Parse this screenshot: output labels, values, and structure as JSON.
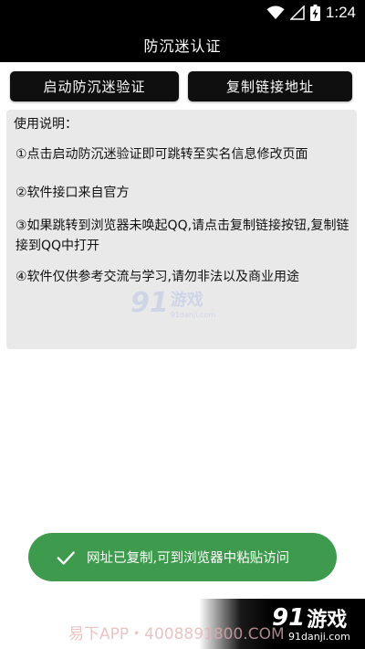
{
  "status_bar": {
    "time": "1:24",
    "icons": [
      "wifi-icon",
      "signal-icon",
      "battery-charging-icon"
    ]
  },
  "app_bar": {
    "title": "防沉迷认证"
  },
  "buttons": {
    "start_verify": "启动防沉迷验证",
    "copy_link": "复制链接地址"
  },
  "instructions": {
    "title": "使用说明：",
    "items": [
      "①点击启动防沉迷验证即可跳转至实名信息修改页面",
      "②软件接口来自官方",
      "③如果跳转到浏览器未唤起QQ,请点击复制链接按钮,复制链接到QQ中打开",
      "④软件仅供参考交流与学习,请勿非法以及商业用途"
    ]
  },
  "toast": {
    "message": "网址已复制,可到浏览器中粘贴访问",
    "icon": "check-icon",
    "color": "#3e9a4c"
  },
  "watermark": {
    "logo_number": "91",
    "logo_text": "游戏",
    "logo_url": "91danji.com",
    "bottom_text": "易下APP・4008891800.COM"
  },
  "brand": {
    "number": "91",
    "name": "游戏",
    "url": "91danji.com"
  }
}
